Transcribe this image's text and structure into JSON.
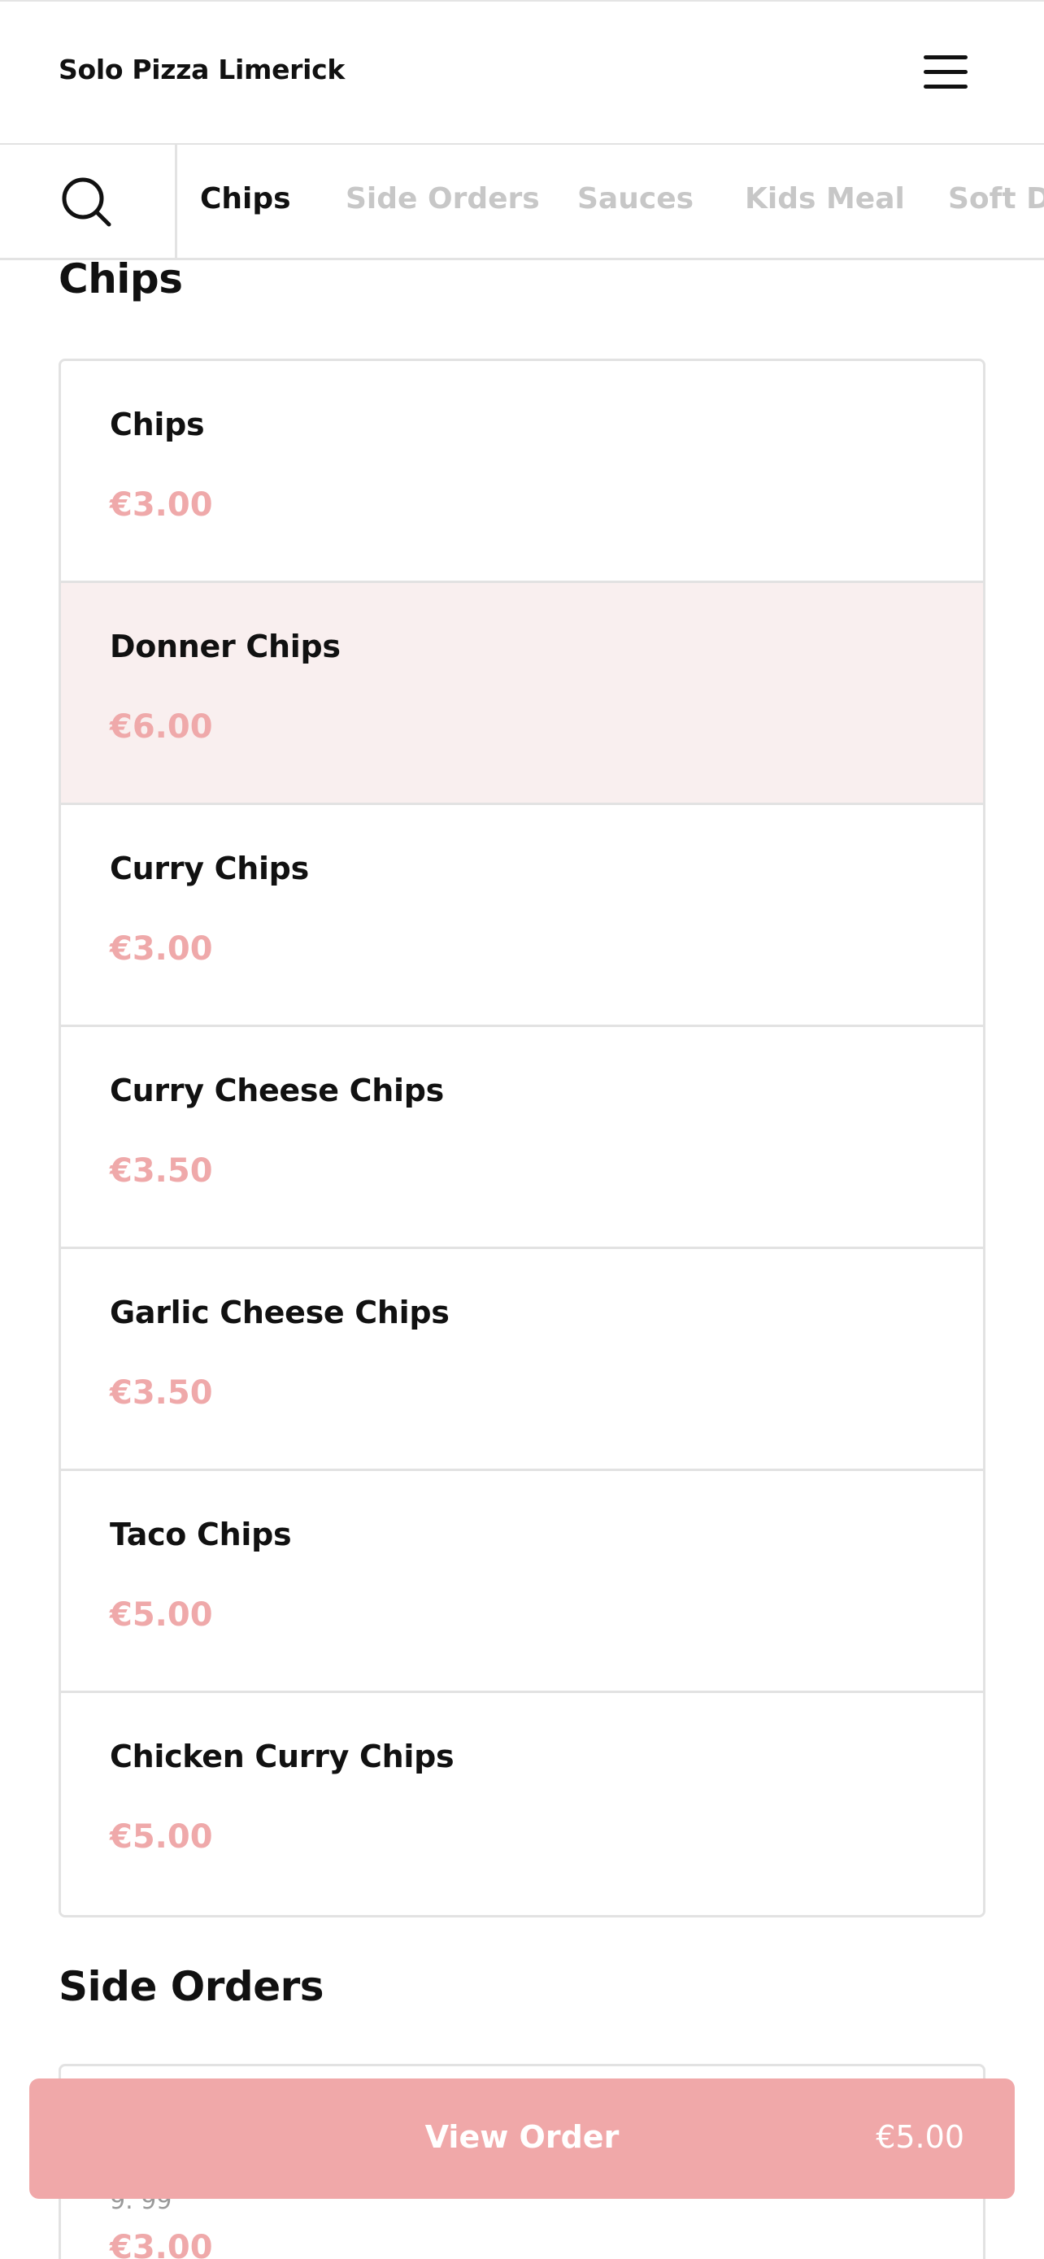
{
  "header": {
    "title": "Solo Pizza Limerick",
    "menu_icon": "hamburger-menu-icon"
  },
  "search": {
    "icon": "search-icon"
  },
  "tabs": [
    {
      "label": "Chips",
      "active": true
    },
    {
      "label": "Side Orders",
      "active": false
    },
    {
      "label": "Sauces",
      "active": false
    },
    {
      "label": "Kids Meal",
      "active": false
    },
    {
      "label": "Soft Dr",
      "active": false
    }
  ],
  "sections": [
    {
      "title": "Chips",
      "items": [
        {
          "name": "Chips",
          "price": "€3.00"
        },
        {
          "name": "Donner Chips",
          "price": "€6.00"
        },
        {
          "name": "Curry Chips",
          "price": "€3.00"
        },
        {
          "name": "Curry Cheese Chips",
          "price": "€3.50"
        },
        {
          "name": "Garlic Cheese Chips",
          "price": "€3.50"
        },
        {
          "name": "Taco Chips",
          "price": "€5.00"
        },
        {
          "name": "Chicken Curry Chips",
          "price": "€5.00"
        }
      ]
    },
    {
      "title": "Side Orders",
      "items": [
        {
          "name": "",
          "description": "9. 99",
          "price": "€3.00"
        }
      ]
    }
  ],
  "order_bar": {
    "label": "View Order",
    "total": "€5.00"
  },
  "colors": {
    "accent": "#f0a8a9",
    "price": "#efa9aa",
    "highlight_row": "#f9efef",
    "inactive_tab": "#c7c7c7"
  }
}
